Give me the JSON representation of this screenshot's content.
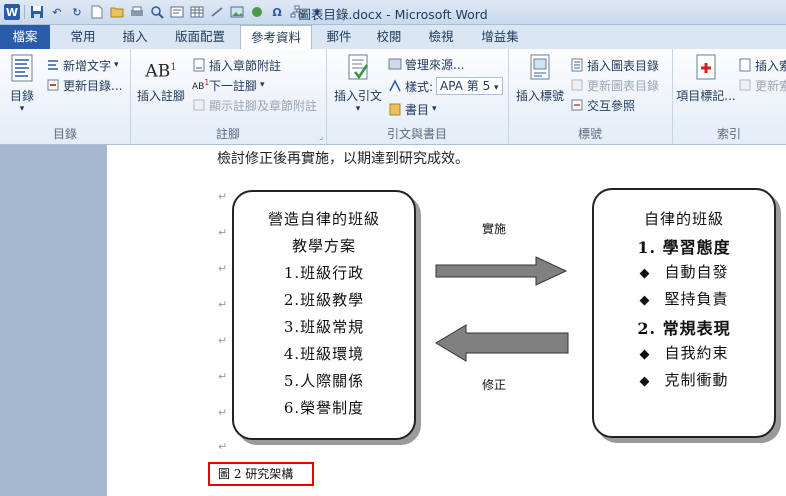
{
  "window": {
    "title": "圖表目錄.docx - Microsoft Word"
  },
  "tabs": [
    "檔案",
    "常用",
    "插入",
    "版面配置",
    "參考資料",
    "郵件",
    "校閱",
    "檢視",
    "增益集"
  ],
  "active_tab": "參考資料",
  "ribbon": {
    "toc": {
      "label": "目錄",
      "add_text": "新增文字",
      "update": "更新目錄...",
      "group": "目錄"
    },
    "footnotes": {
      "insert_footnote": "插入註腳",
      "insert_endnote": "插入章節附註",
      "next_footnote": "下一註腳",
      "show_notes": "顯示註腳及章節附註",
      "group": "註腳"
    },
    "citations": {
      "insert_citation": "插入引文",
      "manage_sources": "管理來源...",
      "style_label": "樣式:",
      "style_value": "APA 第 5",
      "bibliography": "書目",
      "group": "引文與書目"
    },
    "captions": {
      "insert_caption": "插入標號",
      "insert_tof": "插入圖表目錄",
      "update_table": "更新圖表目錄",
      "cross_ref": "交互參照",
      "group": "標號"
    },
    "index": {
      "mark_entry": "項目標記...",
      "insert_index": "插入索",
      "update_index": "更新索",
      "group": "索引"
    }
  },
  "document": {
    "top_line": "檢討修正後再實施，以期達到研究成效。",
    "left_box": [
      "營造自律的班級",
      "教學方案",
      "1.班級行政",
      "2.班級教學",
      "3.班級常規",
      "4.班級環境",
      "5.人際關係",
      "6.榮譽制度"
    ],
    "right_box": [
      {
        "text": "自律的班級",
        "bold": false,
        "bullet": false
      },
      {
        "text": "1. 學習態度",
        "bold": true,
        "bullet": false
      },
      {
        "text": "自動自發",
        "bold": false,
        "bullet": true
      },
      {
        "text": "堅持負責",
        "bold": false,
        "bullet": true
      },
      {
        "text": "2. 常規表現",
        "bold": true,
        "bullet": false
      },
      {
        "text": "自我約束",
        "bold": false,
        "bullet": true
      },
      {
        "text": "克制衝動",
        "bold": false,
        "bullet": true
      }
    ],
    "arrow_top_label": "實施",
    "arrow_bottom_label": "修正",
    "caption": "圖 2 研究架構",
    "bullet_glyph": "◆",
    "para_mark": "↵"
  },
  "colors": {
    "accent": "#2a5cab",
    "highlight": "#ee0000"
  }
}
